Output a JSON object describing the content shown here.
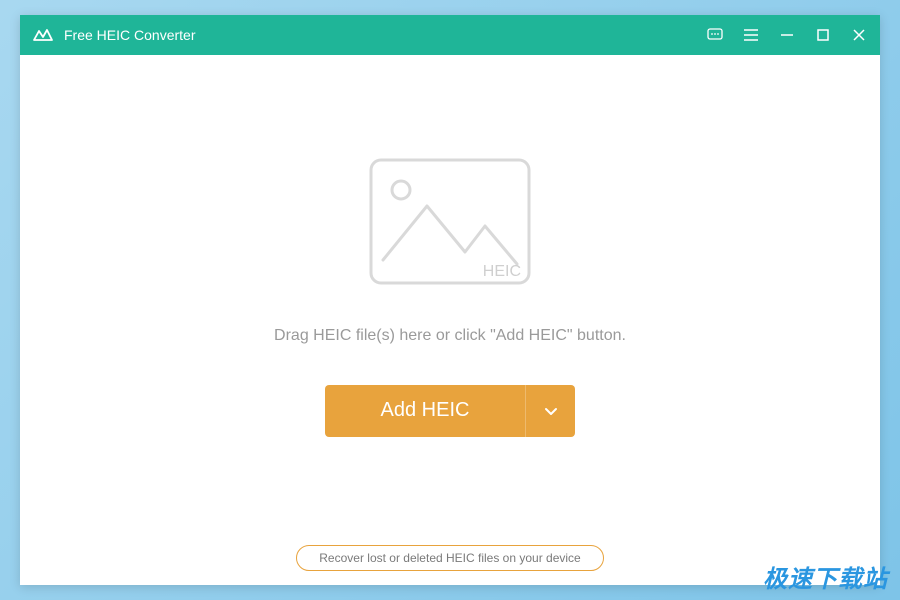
{
  "titlebar": {
    "title": "Free HEIC Converter"
  },
  "main": {
    "placeholder_label": "HEIC",
    "instruction": "Drag HEIC file(s) here or click \"Add HEIC\" button.",
    "add_button_label": "Add HEIC"
  },
  "footer": {
    "recover_link": "Recover lost or deleted HEIC files on your device"
  },
  "watermark": "极速下载站",
  "colors": {
    "accent": "#1fb598",
    "button": "#e8a33d"
  }
}
